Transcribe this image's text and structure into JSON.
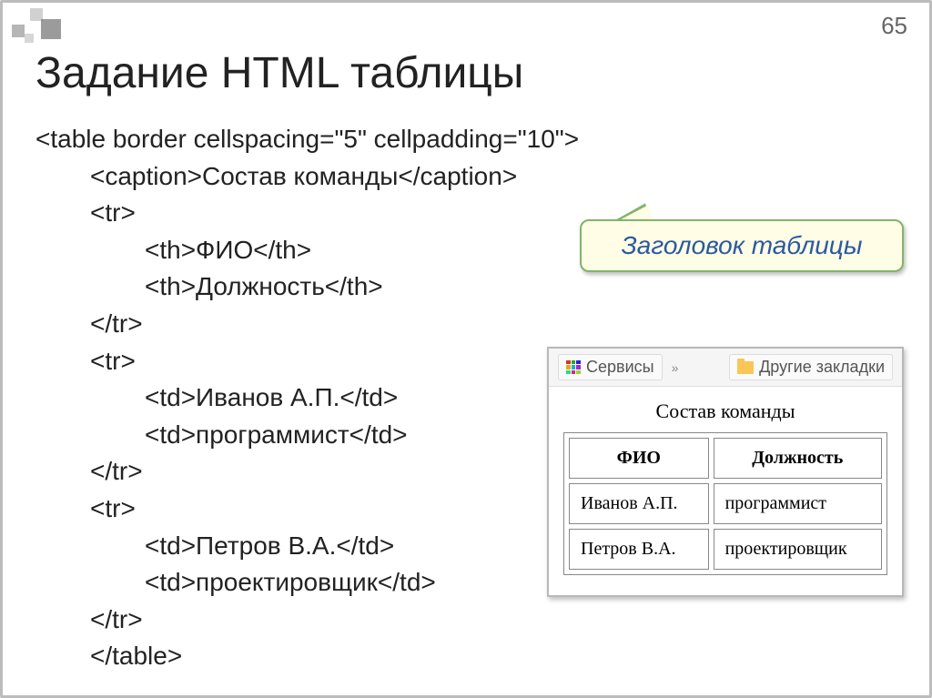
{
  "page_number": "65",
  "slide_title": "Задание HTML таблицы",
  "code": {
    "l1": "<table border cellspacing=\"5\" cellpadding=\"10\">",
    "l2": "<caption>Состав команды</caption>",
    "l3": "<tr>",
    "l4": "<th>ФИО</th>",
    "l5": "<th>Должность</th>",
    "l6": "</tr>",
    "l7": "<tr>",
    "l8": "<td>Иванов А.П.</td>",
    "l9": "<td>программист</td>",
    "l10": "</tr>",
    "l11": "<tr>",
    "l12": "<td>Петров В.А.</td>",
    "l13": "<td>проектировщик</td>",
    "l14": "</tr>",
    "l15": "</table>"
  },
  "callout_text": "Заголовок таблицы",
  "browser": {
    "services_label": "Сервисы",
    "chevrons": "»",
    "bookmarks_label": "Другие закладки",
    "caption": "Состав команды",
    "headers": {
      "col1": "ФИО",
      "col2": "Должность"
    },
    "rows": [
      {
        "c1": "Иванов А.П.",
        "c2": "программист"
      },
      {
        "c1": "Петров В.А.",
        "c2": "проектировщик"
      }
    ]
  }
}
